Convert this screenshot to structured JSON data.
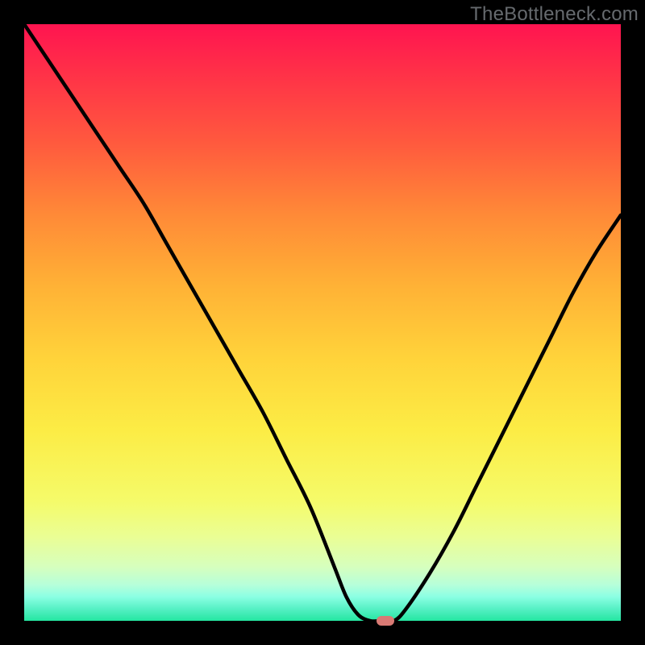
{
  "watermark": "TheBottleneck.com",
  "colors": {
    "frame": "#000000",
    "curve": "#000000",
    "marker": "#d97a74"
  },
  "chart_data": {
    "type": "line",
    "title": "",
    "xlabel": "",
    "ylabel": "",
    "xlim": [
      0,
      100
    ],
    "ylim": [
      0,
      100
    ],
    "grid": false,
    "series": [
      {
        "name": "bottleneck-curve",
        "x": [
          0,
          4,
          8,
          12,
          16,
          20,
          24,
          28,
          32,
          36,
          40,
          44,
          48,
          52,
          54,
          56,
          58,
          60,
          62,
          64,
          68,
          72,
          76,
          80,
          84,
          88,
          92,
          96,
          100
        ],
        "y": [
          100,
          94,
          88,
          82,
          76,
          70,
          63,
          56,
          49,
          42,
          35,
          27,
          19,
          9,
          4,
          1,
          0,
          0,
          0,
          2,
          8,
          15,
          23,
          31,
          39,
          47,
          55,
          62,
          68
        ]
      }
    ],
    "marker": {
      "x": 60.5,
      "y": 0,
      "shape": "pill"
    },
    "background_gradient": [
      {
        "stop": 0,
        "color": "#ff1450"
      },
      {
        "stop": 50,
        "color": "#ffd33a"
      },
      {
        "stop": 85,
        "color": "#eafe95"
      },
      {
        "stop": 100,
        "color": "#24e6a1"
      }
    ]
  }
}
